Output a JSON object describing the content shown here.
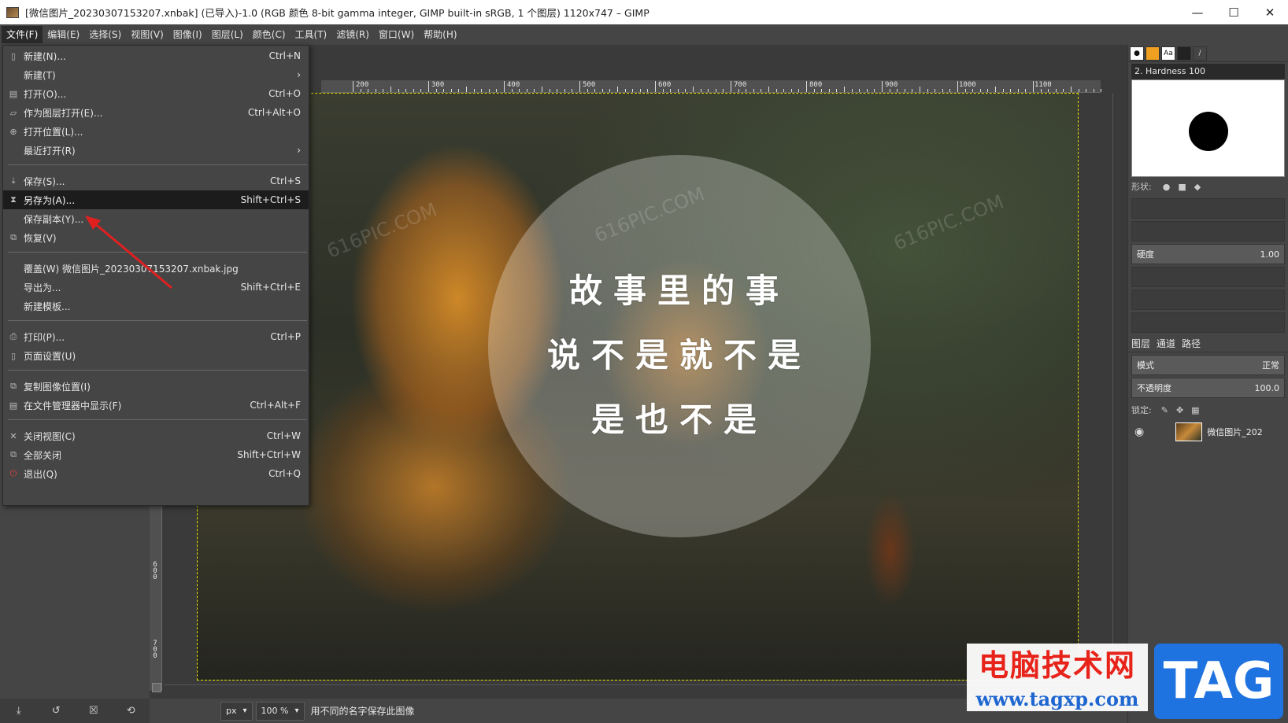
{
  "window": {
    "title": "[微信图片_20230307153207.xnbak] (已导入)-1.0 (RGB 颜色 8-bit gamma integer, GIMP built-in sRGB, 1 个图层) 1120x747 – GIMP",
    "min_icon": "minimize-icon",
    "max_icon": "maximize-icon",
    "close_icon": "close-icon"
  },
  "menubar": [
    "文件(F)",
    "编辑(E)",
    "选择(S)",
    "视图(V)",
    "图像(I)",
    "图层(L)",
    "颜色(C)",
    "工具(T)",
    "滤镜(R)",
    "窗口(W)",
    "帮助(H)"
  ],
  "file_menu": {
    "items": [
      {
        "label": "新建(N)...",
        "shortcut": "Ctrl+N",
        "icon": "new-icon"
      },
      {
        "label": "新建(T)",
        "shortcut": "›",
        "icon": ""
      },
      {
        "label": "打开(O)...",
        "shortcut": "Ctrl+O",
        "icon": "open-icon"
      },
      {
        "label": "作为图层打开(E)...",
        "shortcut": "Ctrl+Alt+O",
        "icon": "open-as-layer-icon"
      },
      {
        "label": "打开位置(L)...",
        "shortcut": "",
        "icon": "open-location-icon"
      },
      {
        "label": "最近打开(R)",
        "shortcut": "›",
        "icon": ""
      },
      {
        "label": "保存(S)...",
        "shortcut": "Ctrl+S",
        "icon": "save-icon"
      },
      {
        "label": "另存为(A)...",
        "shortcut": "Shift+Ctrl+S",
        "icon": "save-as-icon"
      },
      {
        "label": "保存副本(Y)...",
        "shortcut": "",
        "icon": ""
      },
      {
        "label": "恢复(V)",
        "shortcut": "",
        "icon": "revert-icon"
      },
      {
        "label": "覆盖(W) 微信图片_20230307153207.xnbak.jpg",
        "shortcut": "",
        "icon": ""
      },
      {
        "label": "导出为...",
        "shortcut": "Shift+Ctrl+E",
        "icon": ""
      },
      {
        "label": "新建模板...",
        "shortcut": "",
        "icon": ""
      },
      {
        "label": "打印(P)...",
        "shortcut": "Ctrl+P",
        "icon": "print-icon"
      },
      {
        "label": "页面设置(U)",
        "shortcut": "",
        "icon": "page-setup-icon"
      },
      {
        "label": "复制图像位置(I)",
        "shortcut": "",
        "icon": "copy-location-icon"
      },
      {
        "label": "在文件管理器中显示(F)",
        "shortcut": "Ctrl+Alt+F",
        "icon": "file-manager-icon"
      },
      {
        "label": "关闭视图(C)",
        "shortcut": "Ctrl+W",
        "icon": "close-view-icon"
      },
      {
        "label": "全部关闭",
        "shortcut": "Shift+Ctrl+W",
        "icon": "close-all-icon"
      },
      {
        "label": "退出(Q)",
        "shortcut": "Ctrl+Q",
        "icon": "quit-icon"
      }
    ],
    "highlighted": "另存为(A)..."
  },
  "ruler": {
    "top_labels": [
      "200",
      "300",
      "400",
      "500",
      "600",
      "700",
      "800",
      "900",
      "1000",
      "1100"
    ],
    "left_labels": [
      "6\n0\n0",
      "7\n0\n0"
    ]
  },
  "image": {
    "poem_lines": [
      "故事里的事",
      "说不是就不是",
      "是也不是"
    ],
    "watermark": "616PIC.COM"
  },
  "statusbar": {
    "unit": "px",
    "zoom": "100 %",
    "message": "用不同的名字保存此图像"
  },
  "dock": {
    "brush_name": "2. Hardness 100",
    "shape_label": "形状:",
    "hardness_label": "硬度",
    "hardness_value": "1.00",
    "layers_tab": "图层",
    "channels_tab": "通道",
    "paths_tab": "路径",
    "mode_label": "模式",
    "mode_value": "正常",
    "opacity_label": "不透明度",
    "opacity_value": "100.0",
    "lock_label": "锁定:",
    "layer_name": "微信图片_202"
  },
  "watermarks": {
    "cn": "电脑技术网",
    "url": "www.tagxp.com",
    "tag": "TAG"
  }
}
